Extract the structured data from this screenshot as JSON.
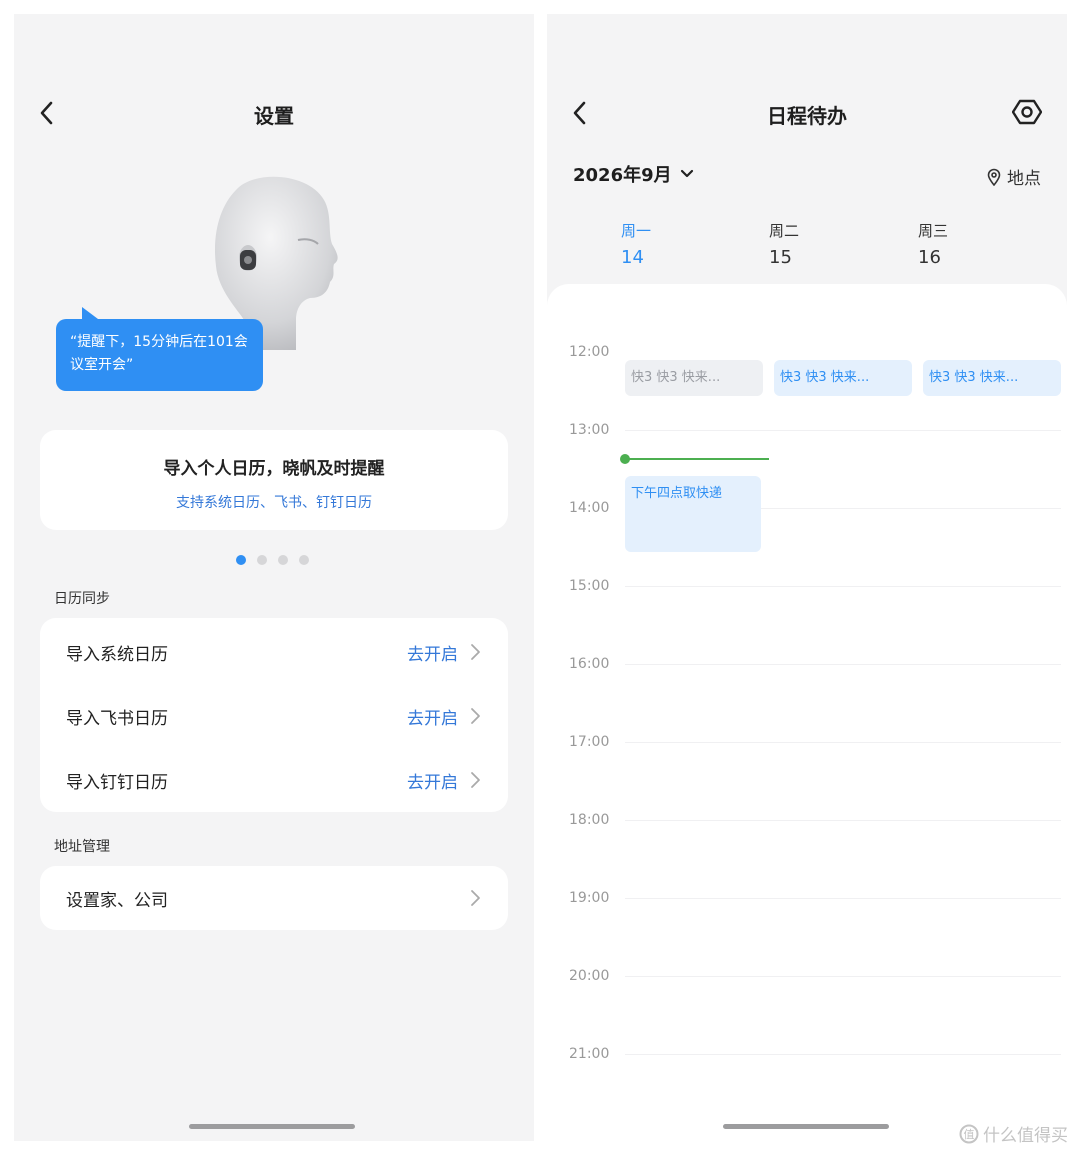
{
  "left": {
    "title": "设置",
    "bubble_text": "“提醒下，15分钟后在101会议室开会”",
    "promo": {
      "title": "导入个人日历，晓帆及时提醒",
      "subtitle": "支持系统日历、飞书、钉钉日历"
    },
    "carousel": {
      "count": 4,
      "active_index": 0
    },
    "calendar_sync": {
      "label": "日历同步",
      "items": [
        {
          "label": "导入系统日历",
          "action": "去开启"
        },
        {
          "label": "导入飞书日历",
          "action": "去开启"
        },
        {
          "label": "导入钉钉日历",
          "action": "去开启"
        }
      ]
    },
    "address": {
      "label": "地址管理",
      "items": [
        {
          "label": "设置家、公司"
        }
      ]
    }
  },
  "right": {
    "title": "日程待办",
    "month": "2026年9月",
    "location": "地点",
    "days": [
      {
        "name": "周一",
        "num": "14"
      },
      {
        "name": "周二",
        "num": "15"
      },
      {
        "name": "周三",
        "num": "16"
      }
    ],
    "active_day": 0,
    "times": [
      "12:00",
      "13:00",
      "14:00",
      "15:00",
      "16:00",
      "17:00",
      "18:00",
      "19:00",
      "20:00",
      "21:00"
    ],
    "allday_events": [
      "快3  快3  快来...",
      "快3  快3  快来...",
      "快3  快3  快来..."
    ],
    "event": {
      "title": "下午四点取快递"
    }
  },
  "watermark": "什么值得买",
  "colors": {
    "accent": "#2f8ff3",
    "link": "#3478d8",
    "now_line": "#4caf50",
    "background": "#f4f4f5"
  }
}
